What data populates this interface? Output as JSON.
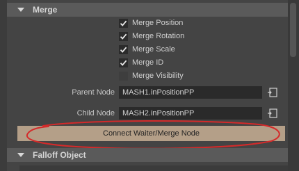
{
  "merge_section": {
    "title": "Merge",
    "checkboxes": [
      {
        "label": "Merge Position",
        "checked": true
      },
      {
        "label": "Merge Rotation",
        "checked": true
      },
      {
        "label": "Merge Scale",
        "checked": true
      },
      {
        "label": "Merge ID",
        "checked": true
      },
      {
        "label": "Merge Visibility",
        "checked": false
      }
    ],
    "parent_node": {
      "label": "Parent Node",
      "value": "MASH1.inPositionPP"
    },
    "child_node": {
      "label": "Child Node",
      "value": "MASH2.inPositionPP"
    },
    "connect_button": "Connect Waiter/Merge Node"
  },
  "falloff_section": {
    "title": "Falloff Object"
  },
  "colors": {
    "panel_bg": "#444444",
    "header_bg": "#5a5a5a",
    "field_bg": "#2a2a2a",
    "button_bg": "#b49f88",
    "annotation_red": "#d42a2a"
  },
  "icons": {
    "collapse_arrow": "triangle-down-icon",
    "checkmark": "checkmark-icon",
    "node_picker": "node-picker-icon"
  }
}
